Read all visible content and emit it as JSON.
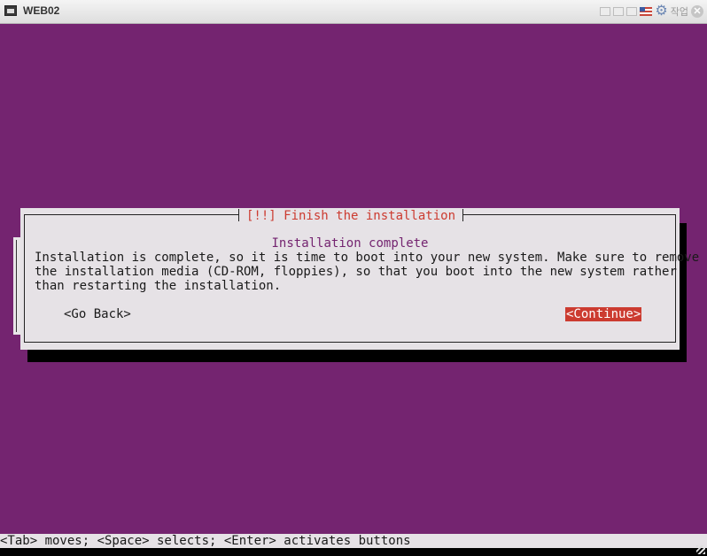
{
  "window": {
    "title": "WEB02",
    "toolbar_text": "작업",
    "close_glyph": "✕"
  },
  "dialog": {
    "title": "[!!] Finish the installation",
    "subtitle": "Installation complete",
    "message_lines": [
      "Installation is complete, so it is time to boot into your new system. Make sure to remove",
      "the installation media (CD-ROM, floppies), so that you boot into the new system rather",
      "than restarting the installation."
    ],
    "go_back_label": "<Go Back>",
    "continue_label": "<Continue>"
  },
  "statusbar": {
    "help_text": "<Tab> moves; <Space> selects; <Enter> activates buttons"
  },
  "colors": {
    "background": "#742470",
    "dialog": "#e6e2e6",
    "accent": "#cc3b30"
  }
}
